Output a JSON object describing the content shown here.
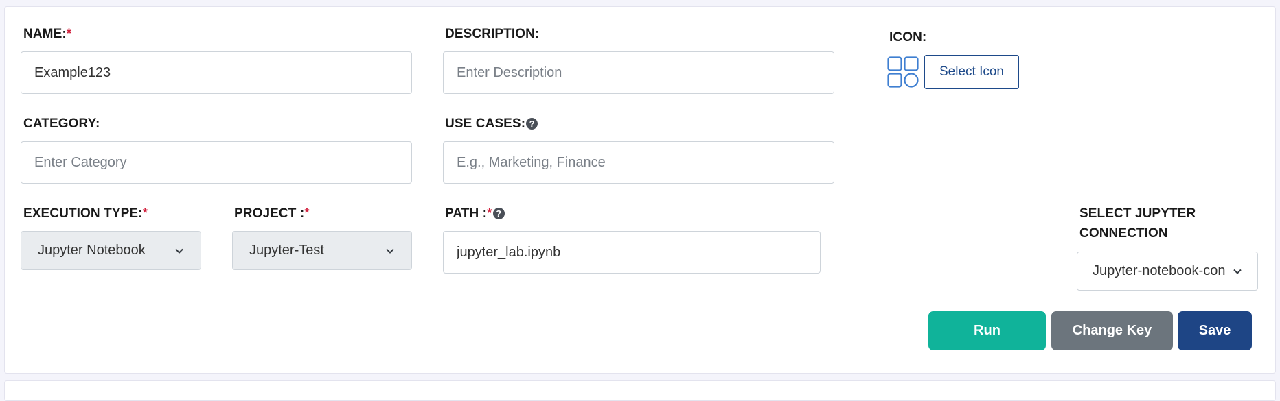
{
  "form": {
    "name": {
      "label": "NAME:",
      "required": "*",
      "value": "Example123"
    },
    "description": {
      "label": "DESCRIPTION:",
      "placeholder": "Enter Description"
    },
    "icon": {
      "label": "ICON:",
      "icon_name": "grid-shapes-icon",
      "button": "Select Icon"
    },
    "category": {
      "label": "CATEGORY:",
      "placeholder": "Enter Category"
    },
    "use_cases": {
      "label": "USE CASES:",
      "help": "?",
      "placeholder": "E.g., Marketing, Finance"
    },
    "execution_type": {
      "label": "EXECUTION TYPE:",
      "required": "*",
      "value": "Jupyter Notebook"
    },
    "project": {
      "label": "PROJECT :",
      "required": "*",
      "value": "Jupyter-Test"
    },
    "path": {
      "label": "PATH :",
      "required": "*",
      "help": "?",
      "value": "jupyter_lab.ipynb"
    },
    "jupyter_connection": {
      "label_line1": "SELECT JUPYTER",
      "label_line2": "CONNECTION",
      "value": "Jupyter-notebook-con"
    }
  },
  "actions": {
    "run": "Run",
    "change_key": "Change Key",
    "save": "Save"
  },
  "colors": {
    "required": "#d21f3c",
    "run": "#10b39a",
    "change_key": "#6c757d",
    "save": "#1e4585",
    "icon": "#3f7fd1"
  }
}
